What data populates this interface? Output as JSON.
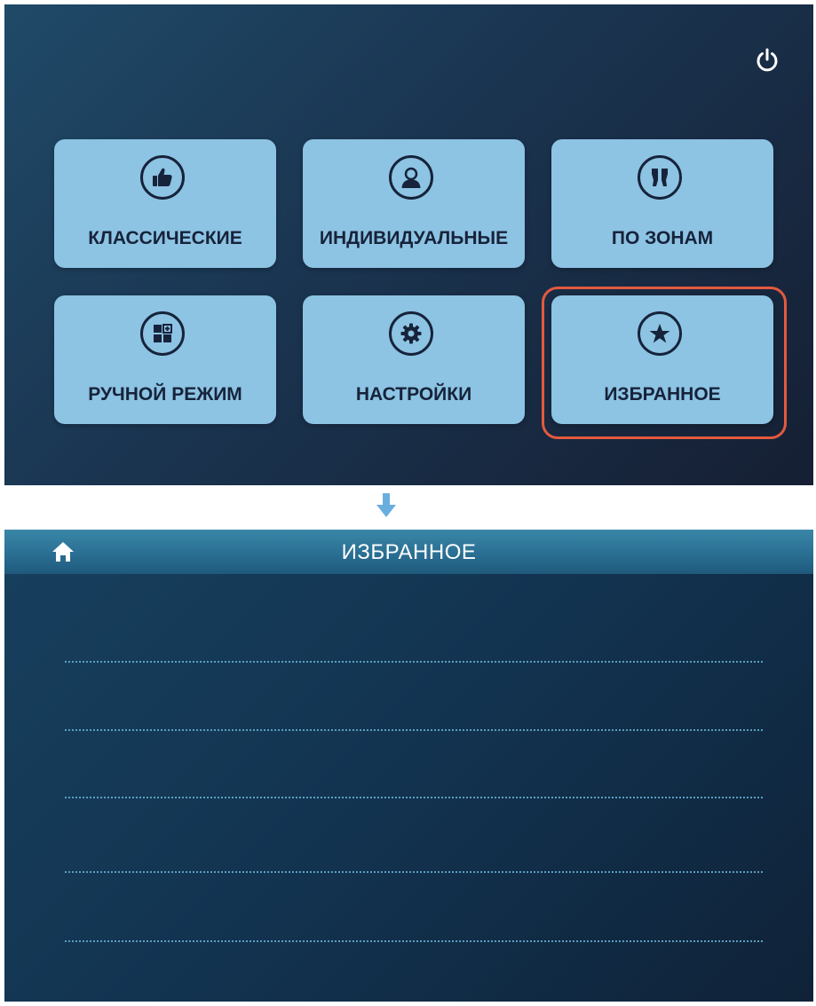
{
  "main_menu": {
    "power_icon": "power-icon",
    "tiles": [
      {
        "label": "КЛАССИЧЕСКИЕ",
        "icon": "thumbs-up-icon"
      },
      {
        "label": "ИНДИВИДУАЛЬНЫЕ",
        "icon": "person-icon"
      },
      {
        "label": "ПО ЗОНАМ",
        "icon": "body-zones-icon"
      },
      {
        "label": "РУЧНОЙ РЕЖИМ",
        "icon": "manual-grid-icon"
      },
      {
        "label": "НАСТРОЙКИ",
        "icon": "gear-icon"
      },
      {
        "label": "ИЗБРАННОЕ",
        "icon": "star-icon"
      }
    ],
    "highlighted_tile": "ИЗБРАННОЕ",
    "highlight_color": "#e35a3e",
    "tile_color": "#8dc3e3"
  },
  "transition_arrow_icon": "arrow-down-icon",
  "favorites_screen": {
    "title": "ИЗБРАННОЕ",
    "home_icon": "home-icon",
    "slots": [
      "",
      "",
      "",
      "",
      ""
    ]
  }
}
